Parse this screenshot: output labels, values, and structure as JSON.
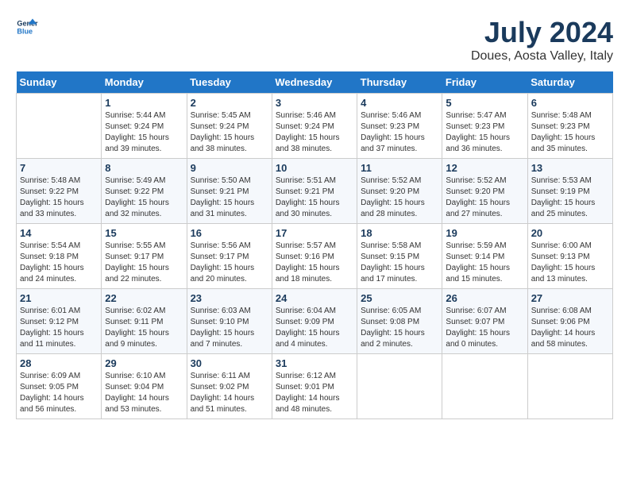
{
  "header": {
    "logo_line1": "General",
    "logo_line2": "Blue",
    "month_year": "July 2024",
    "location": "Doues, Aosta Valley, Italy"
  },
  "days_of_week": [
    "Sunday",
    "Monday",
    "Tuesday",
    "Wednesday",
    "Thursday",
    "Friday",
    "Saturday"
  ],
  "weeks": [
    [
      {
        "day": "",
        "info": ""
      },
      {
        "day": "1",
        "info": "Sunrise: 5:44 AM\nSunset: 9:24 PM\nDaylight: 15 hours\nand 39 minutes."
      },
      {
        "day": "2",
        "info": "Sunrise: 5:45 AM\nSunset: 9:24 PM\nDaylight: 15 hours\nand 38 minutes."
      },
      {
        "day": "3",
        "info": "Sunrise: 5:46 AM\nSunset: 9:24 PM\nDaylight: 15 hours\nand 38 minutes."
      },
      {
        "day": "4",
        "info": "Sunrise: 5:46 AM\nSunset: 9:23 PM\nDaylight: 15 hours\nand 37 minutes."
      },
      {
        "day": "5",
        "info": "Sunrise: 5:47 AM\nSunset: 9:23 PM\nDaylight: 15 hours\nand 36 minutes."
      },
      {
        "day": "6",
        "info": "Sunrise: 5:48 AM\nSunset: 9:23 PM\nDaylight: 15 hours\nand 35 minutes."
      }
    ],
    [
      {
        "day": "7",
        "info": "Sunrise: 5:48 AM\nSunset: 9:22 PM\nDaylight: 15 hours\nand 33 minutes."
      },
      {
        "day": "8",
        "info": "Sunrise: 5:49 AM\nSunset: 9:22 PM\nDaylight: 15 hours\nand 32 minutes."
      },
      {
        "day": "9",
        "info": "Sunrise: 5:50 AM\nSunset: 9:21 PM\nDaylight: 15 hours\nand 31 minutes."
      },
      {
        "day": "10",
        "info": "Sunrise: 5:51 AM\nSunset: 9:21 PM\nDaylight: 15 hours\nand 30 minutes."
      },
      {
        "day": "11",
        "info": "Sunrise: 5:52 AM\nSunset: 9:20 PM\nDaylight: 15 hours\nand 28 minutes."
      },
      {
        "day": "12",
        "info": "Sunrise: 5:52 AM\nSunset: 9:20 PM\nDaylight: 15 hours\nand 27 minutes."
      },
      {
        "day": "13",
        "info": "Sunrise: 5:53 AM\nSunset: 9:19 PM\nDaylight: 15 hours\nand 25 minutes."
      }
    ],
    [
      {
        "day": "14",
        "info": "Sunrise: 5:54 AM\nSunset: 9:18 PM\nDaylight: 15 hours\nand 24 minutes."
      },
      {
        "day": "15",
        "info": "Sunrise: 5:55 AM\nSunset: 9:17 PM\nDaylight: 15 hours\nand 22 minutes."
      },
      {
        "day": "16",
        "info": "Sunrise: 5:56 AM\nSunset: 9:17 PM\nDaylight: 15 hours\nand 20 minutes."
      },
      {
        "day": "17",
        "info": "Sunrise: 5:57 AM\nSunset: 9:16 PM\nDaylight: 15 hours\nand 18 minutes."
      },
      {
        "day": "18",
        "info": "Sunrise: 5:58 AM\nSunset: 9:15 PM\nDaylight: 15 hours\nand 17 minutes."
      },
      {
        "day": "19",
        "info": "Sunrise: 5:59 AM\nSunset: 9:14 PM\nDaylight: 15 hours\nand 15 minutes."
      },
      {
        "day": "20",
        "info": "Sunrise: 6:00 AM\nSunset: 9:13 PM\nDaylight: 15 hours\nand 13 minutes."
      }
    ],
    [
      {
        "day": "21",
        "info": "Sunrise: 6:01 AM\nSunset: 9:12 PM\nDaylight: 15 hours\nand 11 minutes."
      },
      {
        "day": "22",
        "info": "Sunrise: 6:02 AM\nSunset: 9:11 PM\nDaylight: 15 hours\nand 9 minutes."
      },
      {
        "day": "23",
        "info": "Sunrise: 6:03 AM\nSunset: 9:10 PM\nDaylight: 15 hours\nand 7 minutes."
      },
      {
        "day": "24",
        "info": "Sunrise: 6:04 AM\nSunset: 9:09 PM\nDaylight: 15 hours\nand 4 minutes."
      },
      {
        "day": "25",
        "info": "Sunrise: 6:05 AM\nSunset: 9:08 PM\nDaylight: 15 hours\nand 2 minutes."
      },
      {
        "day": "26",
        "info": "Sunrise: 6:07 AM\nSunset: 9:07 PM\nDaylight: 15 hours\nand 0 minutes."
      },
      {
        "day": "27",
        "info": "Sunrise: 6:08 AM\nSunset: 9:06 PM\nDaylight: 14 hours\nand 58 minutes."
      }
    ],
    [
      {
        "day": "28",
        "info": "Sunrise: 6:09 AM\nSunset: 9:05 PM\nDaylight: 14 hours\nand 56 minutes."
      },
      {
        "day": "29",
        "info": "Sunrise: 6:10 AM\nSunset: 9:04 PM\nDaylight: 14 hours\nand 53 minutes."
      },
      {
        "day": "30",
        "info": "Sunrise: 6:11 AM\nSunset: 9:02 PM\nDaylight: 14 hours\nand 51 minutes."
      },
      {
        "day": "31",
        "info": "Sunrise: 6:12 AM\nSunset: 9:01 PM\nDaylight: 14 hours\nand 48 minutes."
      },
      {
        "day": "",
        "info": ""
      },
      {
        "day": "",
        "info": ""
      },
      {
        "day": "",
        "info": ""
      }
    ]
  ]
}
